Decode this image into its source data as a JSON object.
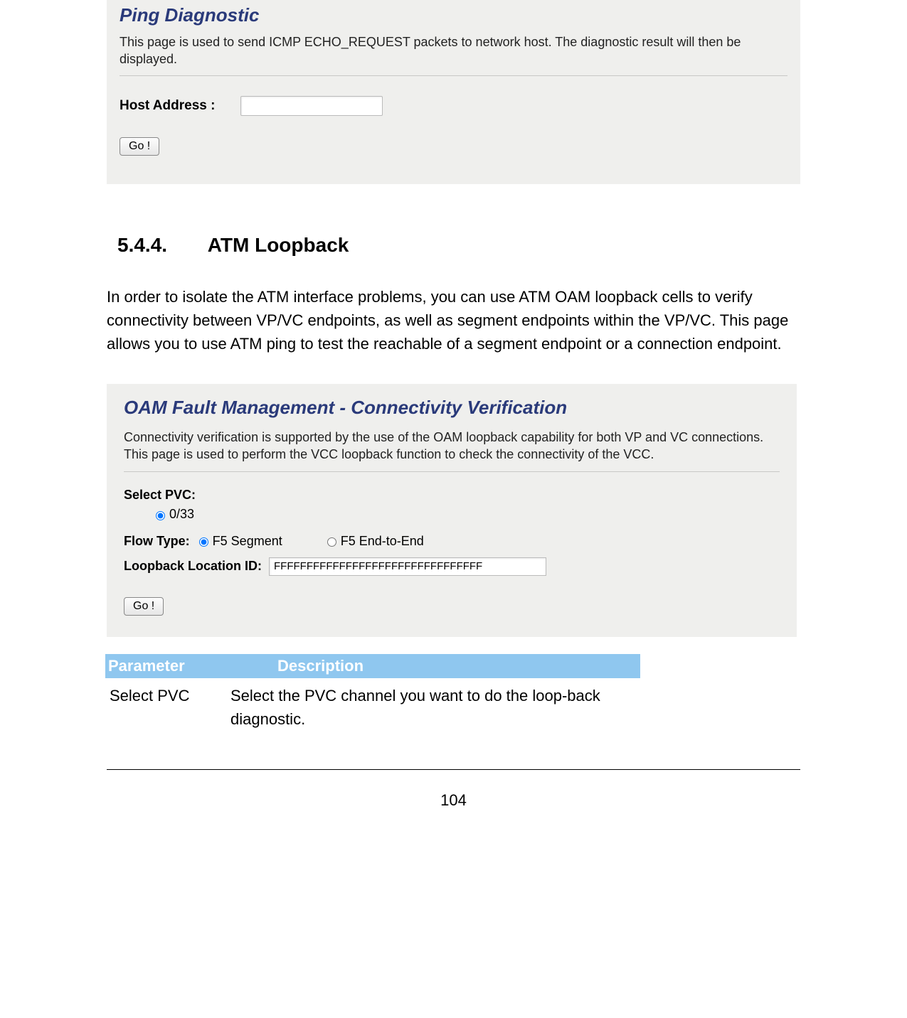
{
  "panel1": {
    "title": "Ping Diagnostic",
    "description": "This page is used to send ICMP ECHO_REQUEST packets to network host. The diagnostic result will then be displayed.",
    "host_label": "Host Address :",
    "host_value": "",
    "go_label": "Go !"
  },
  "section": {
    "number": "5.4.4.",
    "title": "ATM Loopback",
    "body": "In order to isolate the ATM interface problems, you can use ATM OAM loopback cells to verify connectivity between VP/VC endpoints, as well as segment endpoints within the VP/VC. This page allows you to use ATM ping to test the reachable of a segment endpoint or a connection endpoint."
  },
  "panel2": {
    "title": "OAM Fault Management - Connectivity Verification",
    "description": "Connectivity verification is supported by the use of the OAM loopback capability for both VP and VC connections. This page is used to perform the VCC loopback function to check the connectivity of the VCC.",
    "select_pvc_label": "Select PVC:",
    "pvc_option": "0/33",
    "flow_type_label": "Flow Type:",
    "flow_option_segment": "F5 Segment",
    "flow_option_end": "F5 End-to-End",
    "loopback_label": "Loopback Location ID:",
    "loopback_value": "FFFFFFFFFFFFFFFFFFFFFFFFFFFFFFFF",
    "go_label": "Go !"
  },
  "table": {
    "header_param": "Parameter",
    "header_desc": "Description",
    "row1_param": "Select PVC",
    "row1_desc": "Select the PVC channel you want to do the loop-back diagnostic."
  },
  "page_number": "104"
}
